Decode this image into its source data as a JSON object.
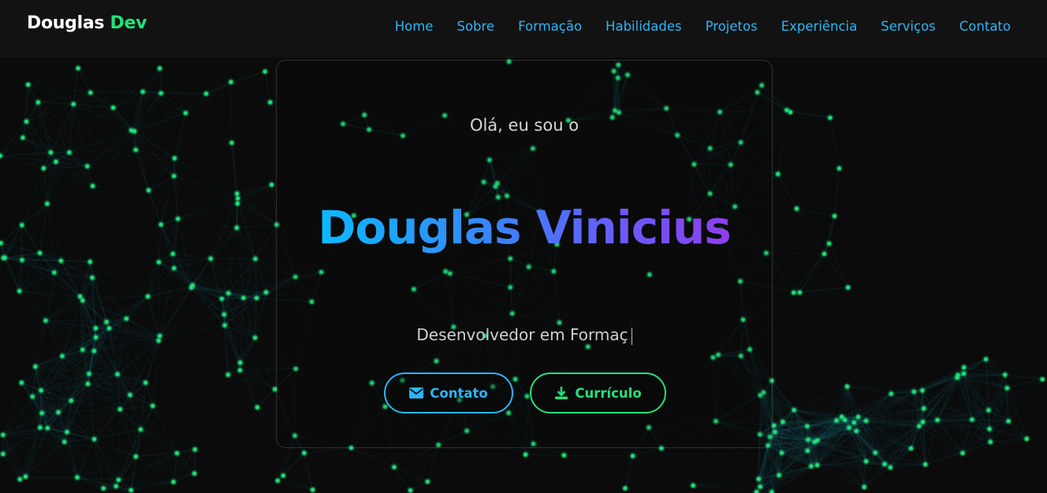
{
  "brand": {
    "name": "Douglas",
    "accent": "Dev"
  },
  "nav": {
    "items": [
      "Home",
      "Sobre",
      "Formação",
      "Habilidades",
      "Projetos",
      "Experiência",
      "Serviços",
      "Contato"
    ]
  },
  "hero": {
    "greeting": "Olá, eu sou o",
    "name": "Douglas Vinicius",
    "subtitle": "Desenvolvedor em Formaç",
    "buttons": {
      "contact": {
        "label": "Contato",
        "icon": "envelope-icon"
      },
      "cv": {
        "label": "Currículo",
        "icon": "download-icon"
      }
    }
  },
  "colors": {
    "background": "#0b0b0b",
    "navbar": "#121212",
    "link": "#29b6f6",
    "accent_green": "#22e27a",
    "name_gradient": [
      "#00c6ff",
      "#3b82f6",
      "#6a5af9",
      "#9b34e6"
    ],
    "particle": "#22e27a",
    "particle_line": "#1fa3b8"
  }
}
